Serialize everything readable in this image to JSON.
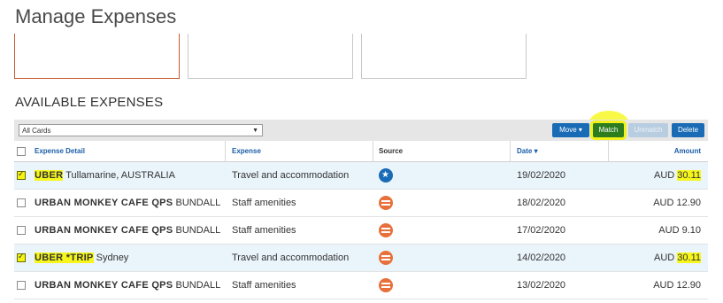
{
  "page": {
    "title": "Manage Expenses"
  },
  "section": {
    "title": "AVAILABLE EXPENSES"
  },
  "toolbar": {
    "card_filter": "All Cards",
    "move_label": "Move ▾",
    "match_label": "Match",
    "unmatch_label": "Unmatch",
    "delete_label": "Delete"
  },
  "table": {
    "headers": {
      "detail": "Expense Detail",
      "expense": "Expense",
      "source": "Source",
      "date": "Date ▾",
      "amount": "Amount"
    },
    "rows": [
      {
        "checked": true,
        "merchant_bold": "UBER",
        "merchant_rest": " Tullamarine, AUSTRALIA",
        "expense": "Travel and accommodation",
        "source": "card-icon",
        "date": "19/02/2020",
        "amount_prefix": "AUD ",
        "amount_value": "30.11"
      },
      {
        "checked": false,
        "merchant_bold": "URBAN MONKEY CAFE QPS",
        "merchant_rest": " BUNDALL",
        "expense": "Staff amenities",
        "source": "receipt-icon",
        "date": "18/02/2020",
        "amount_prefix": "AUD ",
        "amount_value": "12.90"
      },
      {
        "checked": false,
        "merchant_bold": "URBAN MONKEY CAFE QPS",
        "merchant_rest": " BUNDALL",
        "expense": "Staff amenities",
        "source": "receipt-icon",
        "date": "17/02/2020",
        "amount_prefix": "AUD ",
        "amount_value": "9.10"
      },
      {
        "checked": true,
        "merchant_bold": "UBER *TRIP",
        "merchant_rest": " Sydney",
        "expense": "Travel and accommodation",
        "source": "receipt-icon",
        "date": "14/02/2020",
        "amount_prefix": "AUD ",
        "amount_value": "30.11"
      },
      {
        "checked": false,
        "merchant_bold": "URBAN MONKEY CAFE QPS",
        "merchant_rest": " BUNDALL",
        "expense": "Staff amenities",
        "source": "receipt-icon",
        "date": "13/02/2020",
        "amount_prefix": "AUD ",
        "amount_value": "12.90"
      }
    ]
  },
  "colors": {
    "accent": "#1a6bb5",
    "highlight": "#f6f61c",
    "match": "#2d7c1e"
  }
}
